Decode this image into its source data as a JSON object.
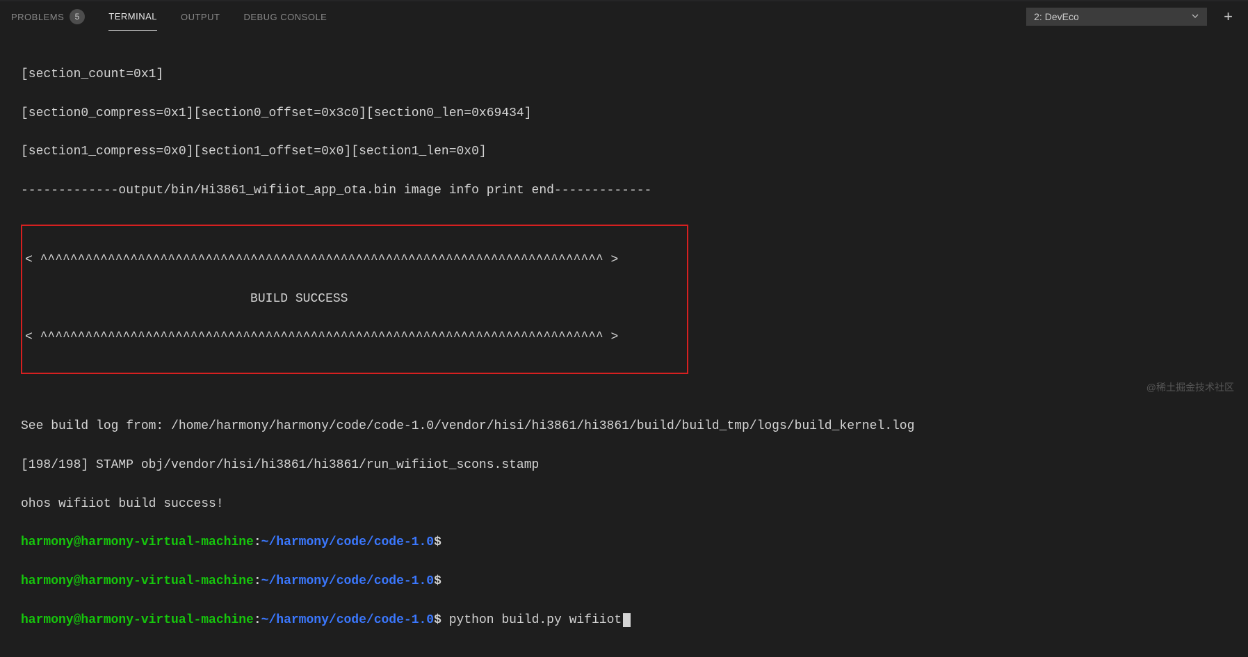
{
  "tabs": {
    "problems": {
      "label": "PROBLEMS",
      "badge": "5"
    },
    "terminal": {
      "label": "TERMINAL"
    },
    "output": {
      "label": "OUTPUT"
    },
    "debug": {
      "label": "DEBUG CONSOLE"
    }
  },
  "dropdown": {
    "selected": "2: DevEco"
  },
  "terminal": {
    "line1": "[section_count=0x1]",
    "line2": "[section0_compress=0x1][section0_offset=0x3c0][section0_len=0x69434]",
    "line3": "[section1_compress=0x0][section1_offset=0x0][section1_len=0x0]",
    "line4": "-------------output/bin/Hi3861_wifiiot_app_ota.bin image info print end-------------",
    "box_line1": "< ^^^^^^^^^^^^^^^^^^^^^^^^^^^^^^^^^^^^^^^^^^^^^^^^^^^^^^^^^^^^^^^^^^^^^^^^^^^ >",
    "box_line2": "                              BUILD SUCCESS",
    "box_line3": "< ^^^^^^^^^^^^^^^^^^^^^^^^^^^^^^^^^^^^^^^^^^^^^^^^^^^^^^^^^^^^^^^^^^^^^^^^^^^ >",
    "line5": "See build log from: /home/harmony/harmony/code/code-1.0/vendor/hisi/hi3861/hi3861/build/build_tmp/logs/build_kernel.log",
    "line6": "[198/198] STAMP obj/vendor/hisi/hi3861/hi3861/run_wifiiot_scons.stamp",
    "line7": "ohos wifiiot build success!",
    "prompt_user": "harmony@harmony-virtual-machine",
    "prompt_path": "~/harmony/code/code-1.0",
    "command": "python build.py wifiiot"
  },
  "watermark": "@稀土掘金技术社区"
}
